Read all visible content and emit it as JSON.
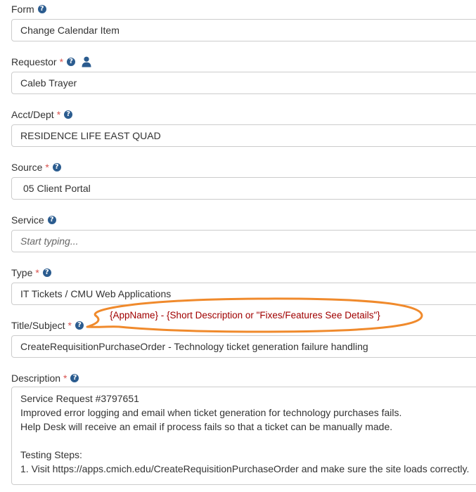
{
  "form": {
    "label": "Form",
    "value": "Change Calendar Item"
  },
  "requestor": {
    "label": "Requestor",
    "required": "*",
    "value": "Caleb Trayer",
    "icon": "user-icon"
  },
  "acct_dept": {
    "label": "Acct/Dept",
    "required": "*",
    "value": "RESIDENCE LIFE EAST QUAD"
  },
  "source": {
    "label": "Source",
    "required": "*",
    "value": "05 Client Portal"
  },
  "service": {
    "label": "Service",
    "placeholder": "Start typing..."
  },
  "type": {
    "label": "Type",
    "required": "*",
    "value": "IT Tickets / CMU Web Applications"
  },
  "title_subject": {
    "label": "Title/Subject",
    "required": "*",
    "value": "CreateRequisitionPurchaseOrder - Technology ticket generation failure handling",
    "annotation": "{AppName} - {Short Description or \"Fixes/Features See Details\"}"
  },
  "description": {
    "label": "Description",
    "required": "*",
    "lines": [
      "Service Request #3797651",
      "Improved error logging and email when ticket generation for technology purchases fails.",
      "Help Desk will receive an email if process fails so that a ticket can be manually made.",
      "",
      "Testing Steps:",
      "1. Visit https://apps.cmich.edu/CreateRequisitionPurchaseOrder and make sure the site loads correctly."
    ]
  },
  "help_glyph": "?",
  "colors": {
    "required": "#d9534f",
    "help_icon": "#2b5c8f",
    "border": "#cccccc",
    "annotation_text": "#a00000",
    "annotation_outline": "#f08a2c"
  }
}
